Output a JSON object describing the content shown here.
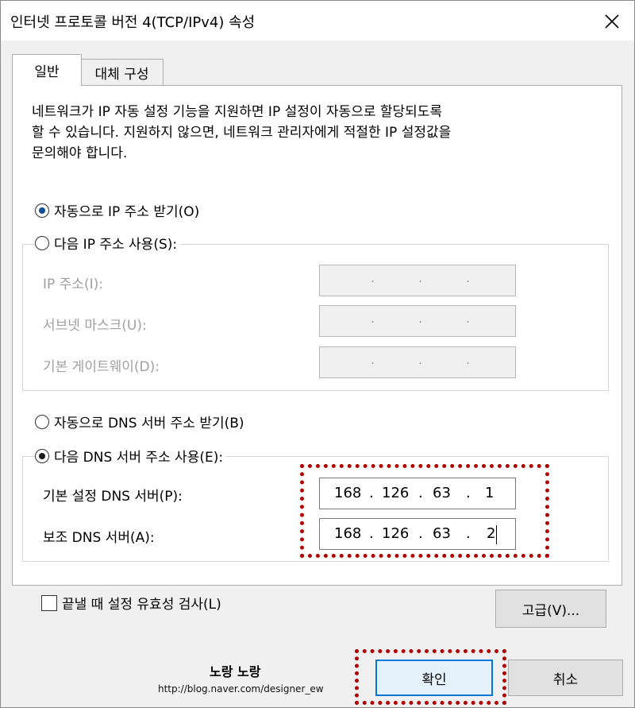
{
  "window": {
    "title": "인터넷 프로토콜 버전 4(TCP/IPv4) 속성"
  },
  "tabs": [
    {
      "label": "일반",
      "active": true
    },
    {
      "label": "대체 구성",
      "active": false
    }
  ],
  "description": [
    "네트워크가 IP 자동 설정 기능을 지원하면 IP 설정이 자동으로 할당되도록",
    "할 수 있습니다. 지원하지 않으면, 네트워크 관리자에게 적절한 IP 설정값을",
    "문의해야 합니다."
  ],
  "ip_section": {
    "auto_label": "자동으로 IP 주소 받기(O)",
    "manual_label": "다음 IP 주소 사용(S):",
    "selected": "auto",
    "fields": [
      {
        "label": "IP 주소(I):",
        "value": ""
      },
      {
        "label": "서브넷 마스크(U):",
        "value": ""
      },
      {
        "label": "기본 게이트웨이(D):",
        "value": ""
      }
    ]
  },
  "dns_section": {
    "auto_label": "자동으로 DNS 서버 주소 받기(B)",
    "manual_label": "다음 DNS 서버 주소 사용(E):",
    "selected": "manual",
    "preferred": {
      "label": "기본 설정 DNS 서버(P):",
      "octets": [
        "168",
        "126",
        "63",
        "1"
      ]
    },
    "alternate": {
      "label": "보조 DNS 서버(A):",
      "octets": [
        "168",
        "126",
        "63",
        "2"
      ]
    }
  },
  "validate": {
    "label": "끝낼 때 설정 유효성 검사(L)",
    "checked": false
  },
  "buttons": {
    "advanced": "고급(V)...",
    "ok": "확인",
    "cancel": "취소"
  },
  "watermark": {
    "title": "노랑 노랑",
    "url": "http://blog.naver.com/designer_ew"
  },
  "colors": {
    "highlight": "#b00000",
    "ok_border": "#0078d7",
    "radio_fill": "#0e4f95"
  },
  "icons": {
    "close": "close-icon"
  }
}
